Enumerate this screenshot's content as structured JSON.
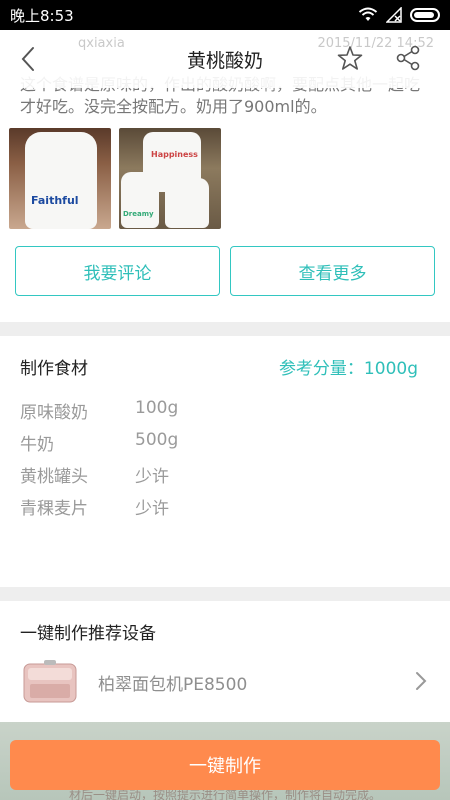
{
  "status_bar": {
    "time": "晚上8:53"
  },
  "header": {
    "title": "黄桃酸奶",
    "ghost_user": "qxiaxia",
    "ghost_date": "2015/11/22 14:52"
  },
  "description": "这个食谱是原味的，作出的酸奶酸啊，要配点其他一起吃才好吃。没完全按配方。奶用了900ml的。",
  "photos": [
    {
      "label": "Faithful"
    },
    {
      "label": "Happiness",
      "label2": "Dreamy"
    }
  ],
  "actions": {
    "comment_label": "我要评论",
    "more_label": "查看更多"
  },
  "ingredients": {
    "title": "制作食材",
    "portion": "参考分量：1000g",
    "items": [
      {
        "name": "原味酸奶",
        "amount": "100g"
      },
      {
        "name": "牛奶",
        "amount": "500g"
      },
      {
        "name": "黄桃罐头",
        "amount": "少许"
      },
      {
        "name": "青稞麦片",
        "amount": "少许"
      }
    ]
  },
  "device": {
    "title": "一键制作推荐设备",
    "name": "柏翠面包机PE8500"
  },
  "bottom": {
    "cta_label": "一键制作",
    "hint": "材后一键启动，按照提示进行简单操作，制作将自动完成。"
  },
  "colors": {
    "accent": "#2fbfb9",
    "cta": "#ff8a4d"
  }
}
